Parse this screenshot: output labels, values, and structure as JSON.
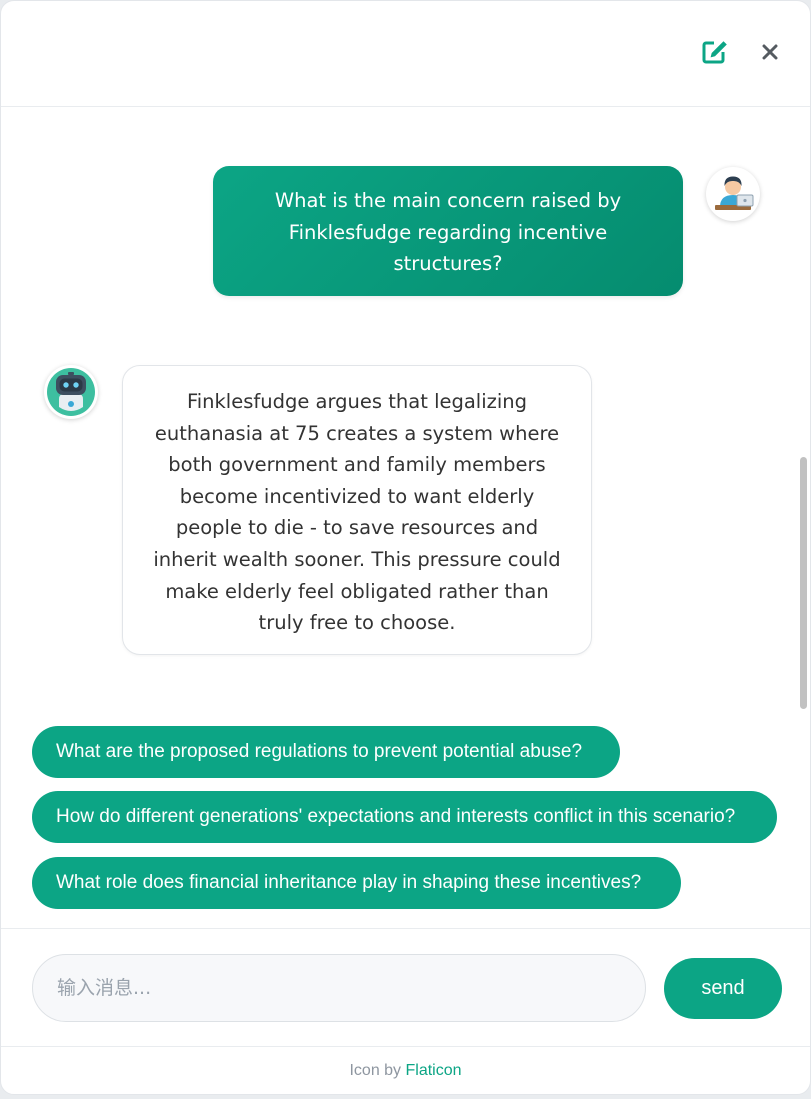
{
  "header": {
    "edit_icon": "edit-icon",
    "close_icon": "close-icon"
  },
  "messages": [
    {
      "role": "user",
      "text": "What is the main concern raised by Finklesfudge regarding incentive structures?"
    },
    {
      "role": "bot",
      "text": "Finklesfudge argues that legalizing euthanasia at 75 creates a system where both government and family members become incentivized to want elderly people to die - to save resources and inherit wealth sooner. This pressure could make elderly feel obligated rather than truly free to choose."
    }
  ],
  "suggestions": [
    "What are the proposed regulations to prevent potential abuse?",
    "How do different generations' expectations and interests conflict in this scenario?",
    "What role does financial inheritance play in shaping these incentives?"
  ],
  "input": {
    "placeholder": "输入消息...",
    "value": ""
  },
  "send_label": "send",
  "footer": {
    "prefix": "Icon by ",
    "link_text": "Flaticon"
  },
  "colors": {
    "accent": "#0ca585",
    "accent_dark": "#058c6f",
    "background": "#ffffff"
  }
}
